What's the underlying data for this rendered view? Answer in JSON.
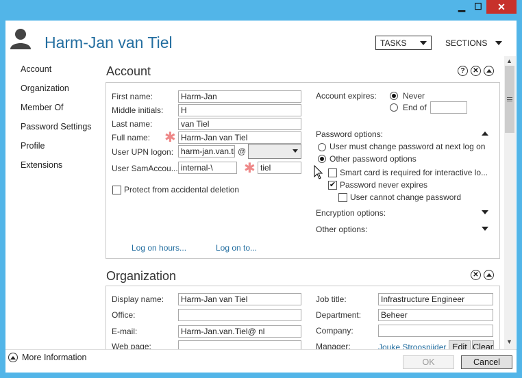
{
  "window": {
    "min": "▁",
    "max": "☐",
    "close": "✕"
  },
  "header": {
    "title": "Harm-Jan van Tiel",
    "tasks_label": "TASKS",
    "sections_label": "SECTIONS"
  },
  "nav": {
    "items": [
      "Account",
      "Organization",
      "Member Of",
      "Password Settings",
      "Profile",
      "Extensions"
    ]
  },
  "account": {
    "title": "Account",
    "help": "?",
    "first_name_label": "First name:",
    "first_name": "Harm-Jan",
    "middle_initials_label": "Middle initials:",
    "middle_initials": "H",
    "last_name_label": "Last name:",
    "last_name": "van Tiel",
    "full_name_label": "Full name:",
    "full_name": "Harm-Jan van Tiel",
    "upn_label": "User UPN logon:",
    "upn_user": "harm-jan.van.ti",
    "upn_at": "@",
    "upn_domain": "",
    "sam_label": "User SamAccou...",
    "sam_domain": "internal-\\",
    "sam_sep": "\\",
    "sam_user": "tiel",
    "protect_label": "Protect from accidental deletion",
    "logon_hours": "Log on hours...",
    "logon_to": "Log on to...",
    "expires_label": "Account expires:",
    "never_label": "Never",
    "end_of_label": "End of",
    "end_of_value": "",
    "pwd_options_label": "Password options:",
    "pwd_must_change": "User must change password at next log on",
    "pwd_other": "Other password options",
    "smart_card": "Smart card is required for interactive lo...",
    "pwd_never_expires": "Password never expires",
    "cannot_change": "User cannot change password",
    "encryption_label": "Encryption options:",
    "other_options_label": "Other options:"
  },
  "organization": {
    "title": "Organization",
    "display_name_label": "Display name:",
    "display_name": "Harm-Jan van Tiel",
    "office_label": "Office:",
    "office": "",
    "email_label": "E-mail:",
    "email": "Harm-Jan.van.Tiel@         nl",
    "web_label": "Web page:",
    "web": "",
    "job_title_label": "Job title:",
    "job_title": "Infrastructure Engineer",
    "department_label": "Department:",
    "department": "Beheer",
    "company_label": "Company:",
    "company": "",
    "manager_label": "Manager:",
    "manager": "Jouke Stroosnijder",
    "edit_label": "Edit",
    "clear_label": "Clear"
  },
  "footer": {
    "more_info": "More Information",
    "ok": "OK",
    "cancel": "Cancel"
  }
}
